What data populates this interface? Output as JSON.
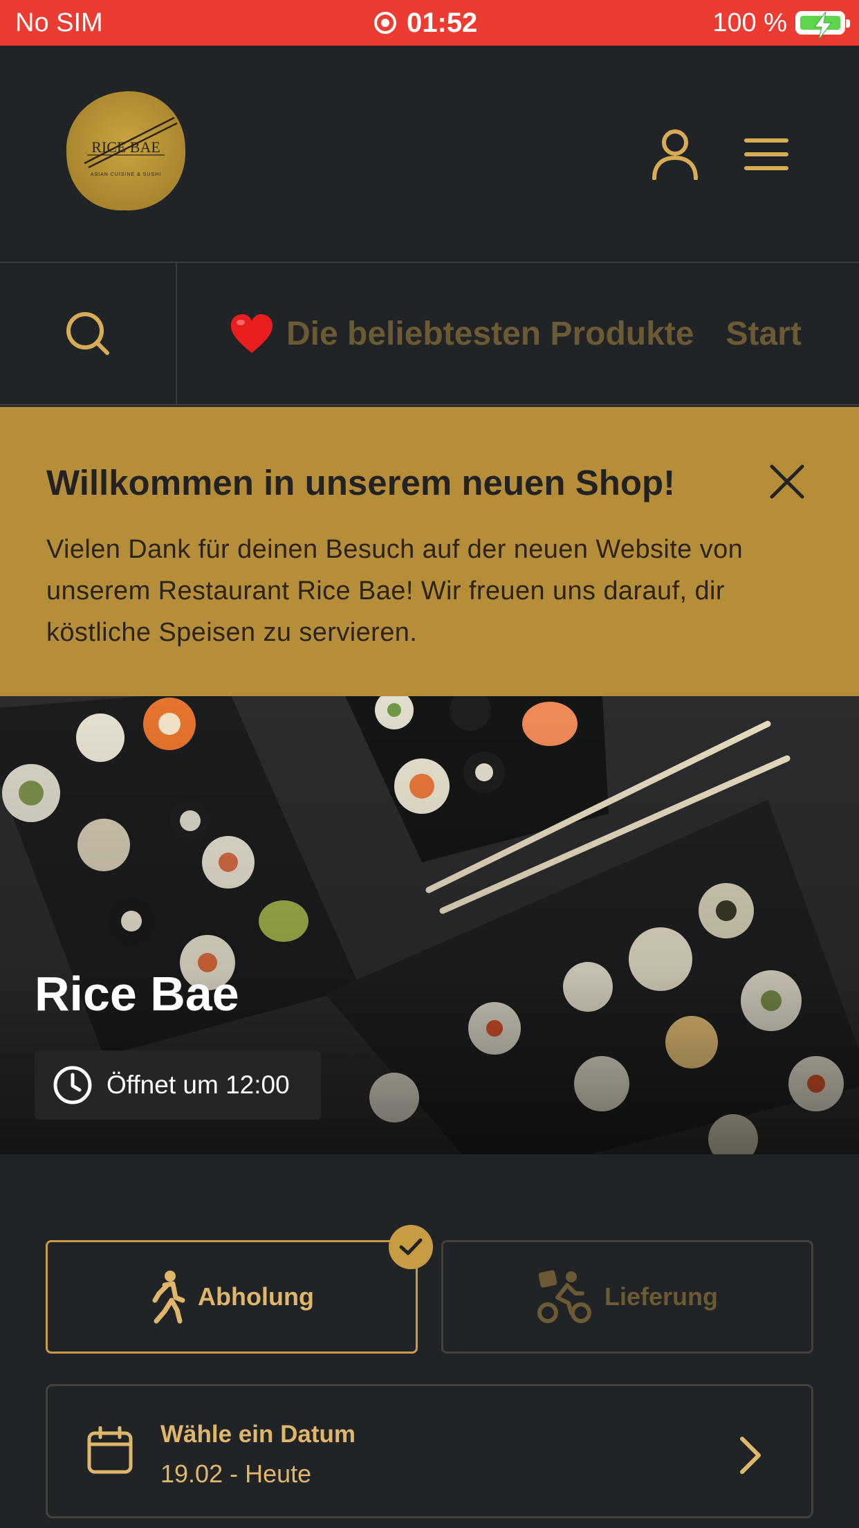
{
  "status_bar": {
    "carrier": "No SIM",
    "time": "01:52",
    "battery": "100 %",
    "battery_color": "#5ed44c",
    "bar_color": "#ec3b30"
  },
  "header": {
    "logo": {
      "title": "RICE BAE",
      "subtitle": "ASIAN CUISINE & SUSHI"
    },
    "user_icon": "user-icon",
    "menu_icon": "menu-icon"
  },
  "nav": {
    "search_icon": "search-icon",
    "items": [
      {
        "emoji": "heart",
        "label": "Die beliebtesten Produkte"
      },
      {
        "label": "Start"
      }
    ]
  },
  "banner": {
    "title": "Willkommen in unserem neuen Shop!",
    "text": "Vielen Dank für deinen Besuch auf der neuen Website von unserem Restaurant Rice Bae! Wir freuen uns darauf, dir köstliche Speisen zu servieren.",
    "color": "#b68e3a"
  },
  "hero": {
    "title": "Rice Bae",
    "hours": "Öffnet um 12:00"
  },
  "order_options": {
    "pickup": {
      "label": "Abholung",
      "selected": true
    },
    "delivery": {
      "label": "Lieferung",
      "selected": false
    }
  },
  "date_picker": {
    "title": "Wähle ein Datum",
    "value": "19.02 - Heute"
  },
  "colors": {
    "accent": "#c89c42",
    "background": "#212426"
  }
}
